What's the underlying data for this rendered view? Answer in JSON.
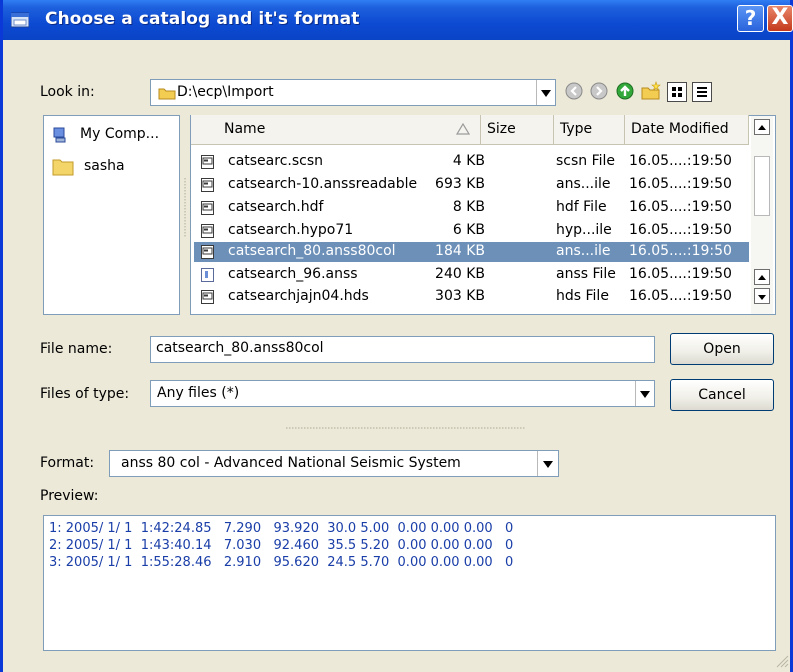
{
  "window": {
    "title": "Choose a catalog and it's format",
    "help_label": "?",
    "close_label": "X"
  },
  "look_in": {
    "label": "Look in:",
    "path": "D:\\ecp\\Import"
  },
  "places": [
    {
      "label": "My Comp..."
    },
    {
      "label": "sasha"
    }
  ],
  "columns": {
    "name": "Name",
    "size": "Size",
    "type": "Type",
    "date": "Date Modified"
  },
  "files": [
    {
      "name": "catsearc.scsn",
      "size": "4 KB",
      "type": "scsn File",
      "date": "16.05....:19:50",
      "selected": false
    },
    {
      "name": "catsearch-10.anssreadable",
      "size": "693 KB",
      "type": "ans...ile",
      "date": "16.05....:19:50",
      "selected": false
    },
    {
      "name": "catsearch.hdf",
      "size": "8 KB",
      "type": "hdf File",
      "date": "16.05....:19:50",
      "selected": false
    },
    {
      "name": "catsearch.hypo71",
      "size": "6 KB",
      "type": "hyp...ile",
      "date": "16.05....:19:50",
      "selected": false
    },
    {
      "name": "catsearch_80.anss80col",
      "size": "184 KB",
      "type": "ans...ile",
      "date": "16.05....:19:50",
      "selected": true
    },
    {
      "name": "catsearch_96.anss",
      "size": "240 KB",
      "type": "anss File",
      "date": "16.05....:19:50",
      "selected": false
    },
    {
      "name": "catsearchjajn04.hds",
      "size": "303 KB",
      "type": "hds File",
      "date": "16.05....:19:50",
      "selected": false
    }
  ],
  "file_name": {
    "label": "File name:",
    "value": "catsearch_80.anss80col"
  },
  "files_of_type": {
    "label": "Files of type:",
    "value": "Any files (*)"
  },
  "buttons": {
    "open": "Open",
    "cancel": "Cancel"
  },
  "format": {
    "label": "Format:",
    "value": "anss 80 col - Advanced National Seismic System"
  },
  "preview": {
    "label": "Preview:",
    "lines": [
      "1: 2005/ 1/ 1  1:42:24.85   7.290   93.920  30.0 5.00  0.00 0.00 0.00   0",
      "2: 2005/ 1/ 1  1:43:40.14   7.030   92.460  35.5 5.20  0.00 0.00 0.00   0",
      "3: 2005/ 1/ 1  1:55:28.46   2.910   95.620  24.5 5.70  0.00 0.00 0.00   0"
    ]
  },
  "colors": {
    "title_bar": "#0c4ad2",
    "selection": "#6d90b8",
    "preview_text": "#1a3ea8"
  }
}
